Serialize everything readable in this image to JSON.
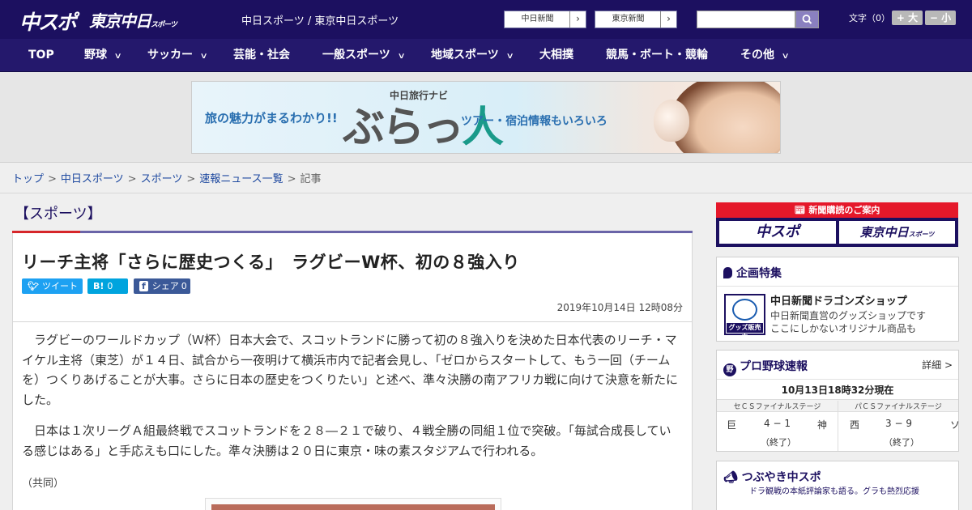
{
  "header": {
    "logo_main": "中スポ",
    "logo_sub": "東京中日",
    "logo_sub_small": "スポーツ",
    "site_title": "中日スポーツ / 東京中日スポーツ",
    "ext_links": [
      {
        "label": "中日新聞"
      },
      {
        "label": "東京新聞"
      }
    ],
    "search_placeholder": "",
    "fontsize_label": "文字（0）",
    "fontsize_plus": "+ 大",
    "fontsize_minus": "− 小"
  },
  "nav": {
    "items": [
      {
        "label": "TOP",
        "dropdown": false
      },
      {
        "label": "野球",
        "dropdown": true
      },
      {
        "label": "サッカー",
        "dropdown": true
      },
      {
        "label": "芸能・社会",
        "dropdown": false
      },
      {
        "label": "一般スポーツ",
        "dropdown": true
      },
      {
        "label": "地域スポーツ",
        "dropdown": true
      },
      {
        "label": "大相撲",
        "dropdown": false
      },
      {
        "label": "競馬・ボート・競輪",
        "dropdown": false
      },
      {
        "label": "その他",
        "dropdown": true
      }
    ]
  },
  "ad": {
    "left": "旅の魅力がまるわかり!!",
    "sub": "中日旅行ナビ",
    "main_a": "ぶらっ",
    "main_b": "人",
    "right": "ツアー・宿泊情報もいろいろ"
  },
  "breadcrumb": {
    "items": [
      "トップ",
      "中日スポーツ",
      "スポーツ",
      "速報ニュース一覧"
    ],
    "current": "記事",
    "separator": ">"
  },
  "article": {
    "section": "【スポーツ】",
    "headline": "リーチ主将「さらに歴史つくる」　ラグビーW杯、初の８強入り",
    "share": {
      "tweet": "ツイート",
      "hatena_icon": "B!",
      "hatena_count": "0",
      "facebook_icon": "f",
      "facebook_label": "シェア",
      "facebook_count": "0"
    },
    "date": "2019年10月14日 12時08分",
    "paragraphs": [
      "ラグビーのワールドカップ（Ｗ杯）日本大会で、スコットランドに勝って初の８強入りを決めた日本代表のリーチ・マイケル主将（東芝）が１４日、試合から一夜明けて横浜市内で記者会見し、「ゼロからスタートして、もう一回（チームを）つくりあげることが大事。さらに日本の歴史をつくりたい」と述べ、準々決勝の南アフリカ戦に向けて決意を新たにした。",
      "日本は１次リーグＡ組最終戦でスコットランドを２８―２１で破り、４戦全勝の同組１位で突破。「毎試合成長している感じはある」と手応えも口にした。準々決勝は２０日に東京・味の素スタジアムで行われる。"
    ],
    "credit": "（共同）"
  },
  "sidebar": {
    "subscribe": {
      "head": "新聞購読のご案内",
      "logo1": "中スポ",
      "logo2": "東京中日",
      "logo2_small": "スポーツ"
    },
    "feature": {
      "title": "企画特集",
      "item_title": "中日新聞ドラゴンズショップ",
      "item_desc1": "中日新聞直営のグッズショップです",
      "item_desc2": "ここにしかないオリジナル商品も",
      "img_tag": "グッズ販売中"
    },
    "scores": {
      "title": "プロ野球速報",
      "ball_label": "野",
      "more": "詳細 >",
      "updated": "10月13日18時32分現在",
      "stages": [
        "セＣＳファイナルステージ",
        "パＣＳファイナルステージ"
      ],
      "games": [
        {
          "home": "巨",
          "score": "4 − 1",
          "away": "神",
          "status": "（終了）"
        },
        {
          "home": "西",
          "score": "3 − 9",
          "away": "ソ",
          "status": "（終了）"
        }
      ]
    },
    "tweets": {
      "title": "つぶやき中スポ",
      "sub": "ドラ観戦の本紙評論家も語る。グラも熱烈応援"
    }
  },
  "colors": {
    "brand_navy": "#1c1060",
    "nav_bg": "#24186c",
    "accent_red": "#d6262a",
    "section_purple": "#6a64a8",
    "link_blue": "#1f4aa0",
    "twitter": "#1da1f2",
    "hatena": "#00a4de",
    "facebook": "#3b5998"
  }
}
